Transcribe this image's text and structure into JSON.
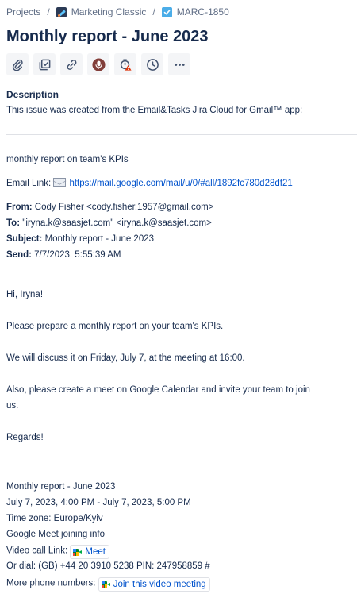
{
  "breadcrumb": {
    "root": "Projects",
    "project": "Marketing Classic",
    "issue_key": "MARC-1850"
  },
  "issue": {
    "title": "Monthly report - June 2023"
  },
  "toolbar": {
    "icons": [
      "attachment-icon",
      "checklist-icon",
      "link-icon",
      "microphone-icon",
      "watch-icon",
      "clock-icon",
      "more-icon"
    ]
  },
  "description": {
    "label": "Description",
    "intro": "This issue was created from the Email&Tasks Jira Cloud for Gmail™ app:",
    "summary": "monthly report on team's KPIs",
    "email_link_label": "Email Link:",
    "email_link_url": "https://mail.google.com/mail/u/0/#all/1892fc780d28df21",
    "from_label": "From:",
    "from_value": "Cody Fisher <cody.fisher.1957@gmail.com>",
    "to_label": "To:",
    "to_value": "\"iryna.k@saasjet.com\" <iryna.k@saasjet.com>",
    "subject_label": "Subject:",
    "subject_value": "Monthly report - June 2023",
    "send_label": "Send:",
    "send_value": "7/7/2023, 5:55:39 AM",
    "body": {
      "greeting": "Hi, Iryna!",
      "p1": "Please prepare a monthly report on your team's KPIs.",
      "p2": "We will discuss it on Friday, July 7, at the meeting at 16:00.",
      "p3_line1": "Also, please create a meet on Google Calendar and invite your team to join",
      "p3_line2": "us.",
      "closing": "Regards!"
    },
    "event": {
      "title": "Monthly report - June 2023",
      "time": "July 7, 2023, 4:00 PM - July 7, 2023, 5:00 PM",
      "timezone": "Time zone: Europe/Kyiv",
      "meet_info": "Google Meet joining info",
      "video_label": "Video call Link:",
      "meet_chip": "Meet",
      "dial": "Or dial: (GB) +44 20 3910 5238 PIN: 247958859 #",
      "phones_label": "More phone numbers:",
      "join_chip": "Join this video meeting"
    }
  },
  "colors": {
    "text": "#172b4d",
    "muted": "#5e6c84",
    "link": "#0052cc",
    "divider": "#dfe1e6",
    "toolbar_bg": "#f4f5f7",
    "task_icon": "#4bade8",
    "mic_accent": "#de350b"
  }
}
